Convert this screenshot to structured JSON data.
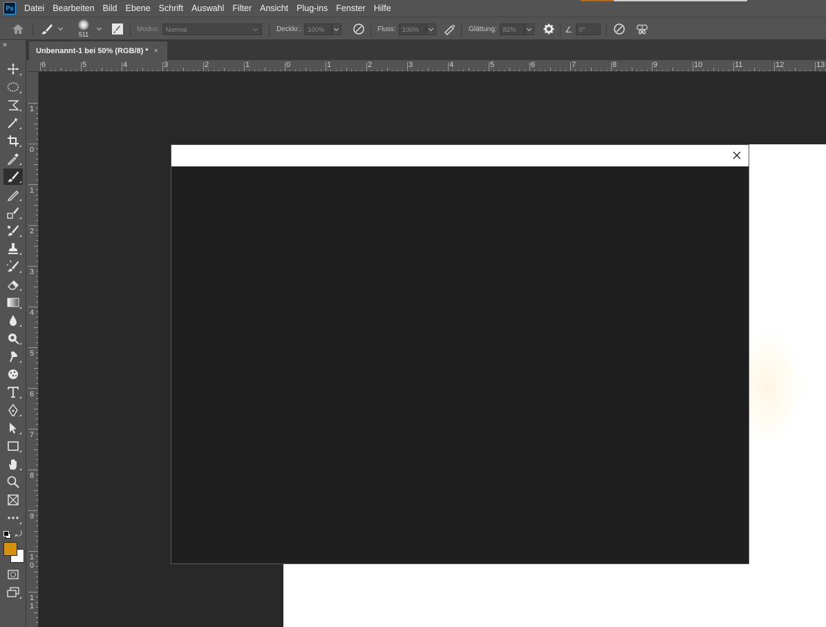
{
  "menubar": {
    "logo": "Ps",
    "items": [
      "Datei",
      "Bearbeiten",
      "Bild",
      "Ebene",
      "Schrift",
      "Auswahl",
      "Filter",
      "Ansicht",
      "Plug-ins",
      "Fenster",
      "Hilfe"
    ]
  },
  "options": {
    "brush_size": "511",
    "mode_label": "Modus:",
    "mode_value": "Normal",
    "opacity_label": "Deckkr.:",
    "opacity_value": "100%",
    "flow_label": "Fluss:",
    "flow_value": "100%",
    "smoothing_label": "Glättung:",
    "smoothing_value": "82%",
    "angle_value": "0°"
  },
  "document": {
    "tab_title": "Unbenannt-1 bei 50% (RGB/8) *",
    "tab_close": "×"
  },
  "ruler": {
    "h_labels": [
      "6",
      "5",
      "4",
      "3",
      "2",
      "1",
      "0",
      "1",
      "2",
      "3",
      "4",
      "5",
      "6",
      "7",
      "8",
      "9",
      "10",
      "11",
      "12",
      "13"
    ],
    "v_labels": [
      "1",
      "0",
      "1",
      "2",
      "3",
      "4",
      "5",
      "6",
      "7",
      "8",
      "9",
      "1\n0",
      "1\n1"
    ]
  },
  "colors": {
    "foreground": "#d4900f",
    "background": "#ffffff",
    "accent": "#31a8ff"
  },
  "toolbar_icons": [
    "move-icon",
    "ellipse-marquee-icon",
    "lasso-icon",
    "magic-wand-icon",
    "crop-icon",
    "eyedropper-icon",
    "brush-icon",
    "pencil-icon",
    "healing-brush-icon",
    "mixer-brush-icon",
    "clone-stamp-icon",
    "history-brush-icon",
    "eraser-icon",
    "gradient-icon",
    "blur-icon",
    "dodge-icon",
    "smudge-icon",
    "sponge-icon",
    "type-icon",
    "pen-icon",
    "path-selection-icon",
    "rectangle-icon",
    "hand-icon",
    "zoom-icon",
    "frame-icon",
    "more-tools-icon"
  ]
}
